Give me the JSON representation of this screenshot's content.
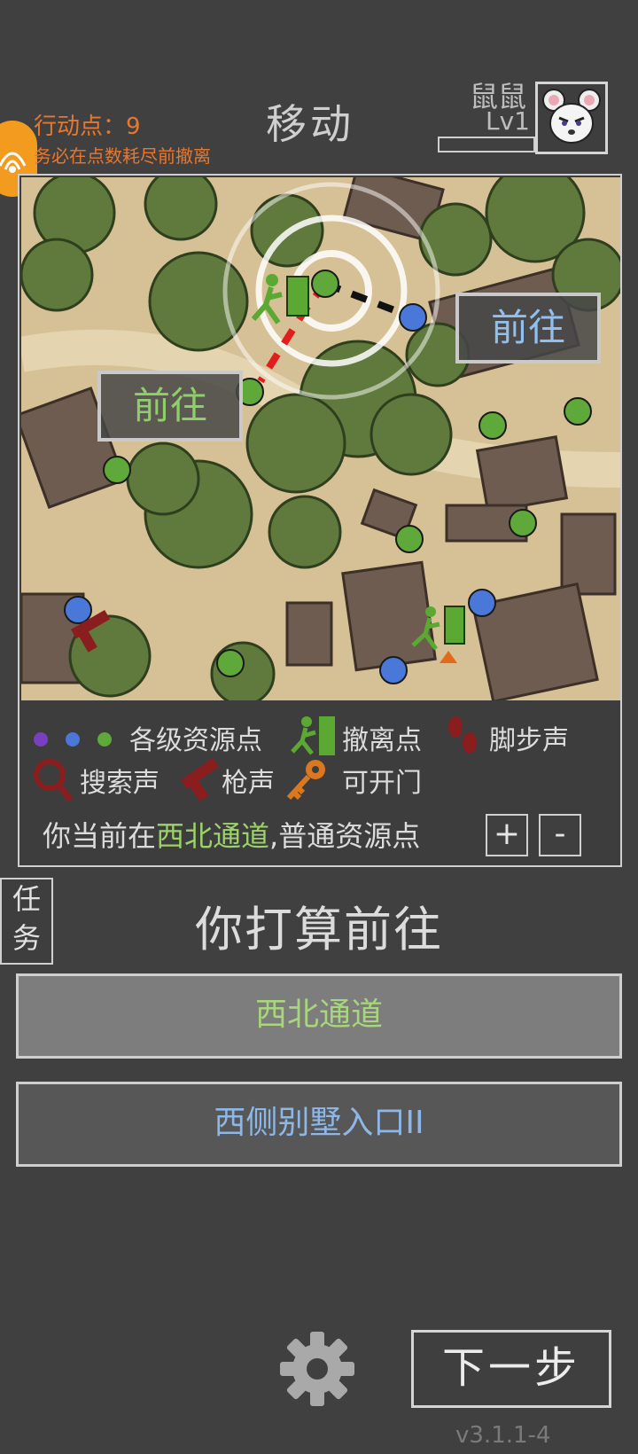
{
  "header": {
    "action_points": "行动点：9",
    "action_hint": "务必在点数耗尽前撤离",
    "title": "移动",
    "player_name": "鼠鼠",
    "player_level": "Lv1"
  },
  "map": {
    "goto_west": "前往",
    "goto_east": "前往"
  },
  "legend": {
    "resource": "各级资源点",
    "evac": "撤离点",
    "footsteps": "脚步声",
    "search": "搜索声",
    "gunshot": "枪声",
    "door": "可开门"
  },
  "location": {
    "prefix": "你当前在",
    "name": "西北通道",
    "suffix": ",普通资源点"
  },
  "controls": {
    "zoom_in": "+",
    "zoom_out": "-"
  },
  "task_tab": {
    "line1": "任",
    "line2": "务"
  },
  "prompt": "你打算前往",
  "options": [
    {
      "label": "西北通道"
    },
    {
      "label": "西侧别墅入口II"
    }
  ],
  "next_button": "下一步",
  "version": "v3.1.1-4",
  "colors": {
    "accent_orange": "#e8772e",
    "resource_purple": "#7a3fbf",
    "resource_blue": "#4a78d8",
    "resource_green": "#5fa83a",
    "gun_red": "#8a1e1e",
    "key_orange": "#d9781e"
  },
  "icons": [
    "compass-badge-icon",
    "mouse-avatar-icon",
    "evac-icon",
    "footprints-icon",
    "search-icon",
    "gun-icon",
    "key-icon",
    "gear-icon"
  ]
}
